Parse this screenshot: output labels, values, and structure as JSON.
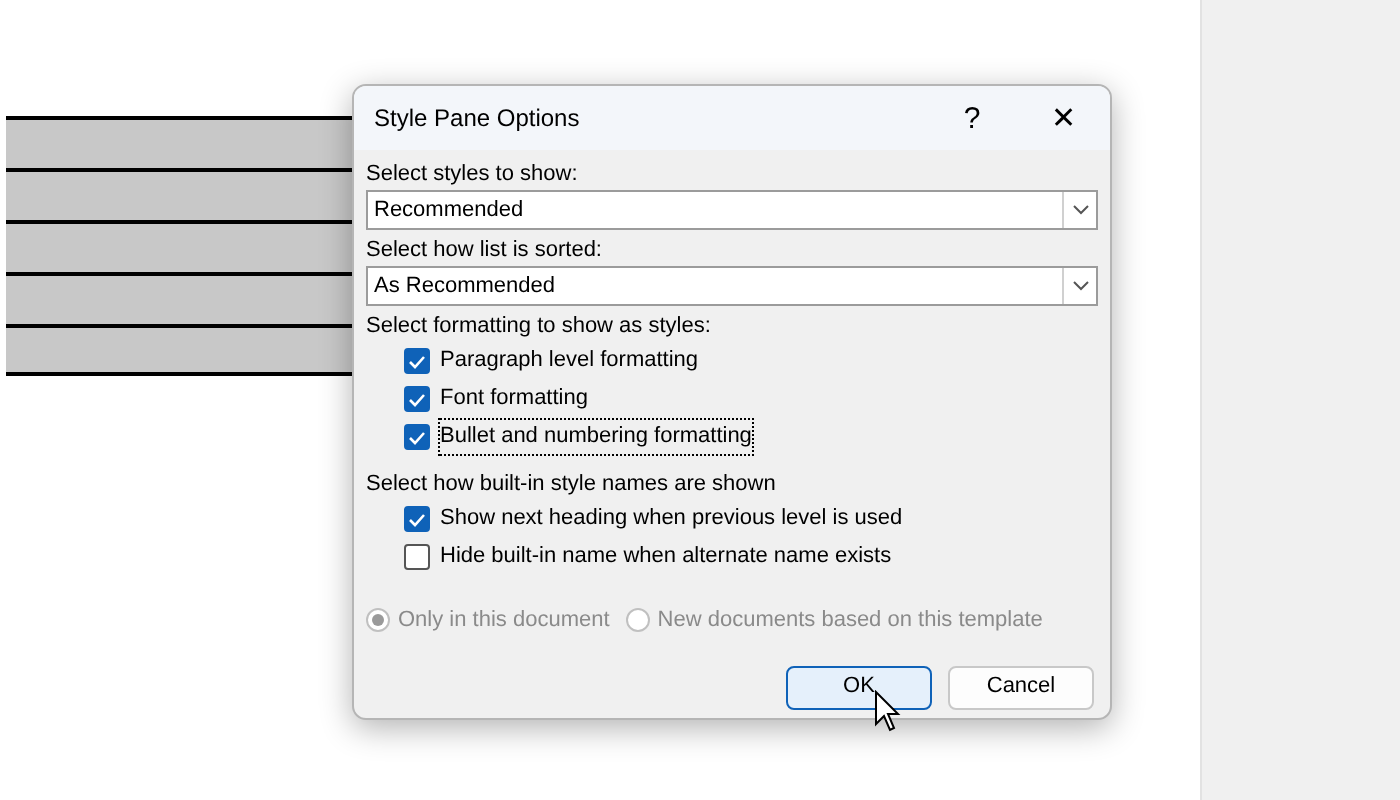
{
  "dialog": {
    "title": "Style Pane Options",
    "help": "?",
    "close": "✕",
    "styles_label": "Select styles to show:",
    "styles_select": {
      "value": "Recommended"
    },
    "sort_label": "Select how list is sorted:",
    "sort_select": {
      "value": "As Recommended"
    },
    "formatting_label": "Select formatting to show as styles:",
    "formatting_options": [
      {
        "label": "Paragraph level formatting",
        "checked": true,
        "focused": false
      },
      {
        "label": "Font formatting",
        "checked": true,
        "focused": false
      },
      {
        "label": "Bullet and numbering formatting",
        "checked": true,
        "focused": true
      }
    ],
    "names_label": "Select how built-in style names are shown",
    "names_options": [
      {
        "label": "Show next heading when previous level is used",
        "checked": true,
        "focused": false
      },
      {
        "label": "Hide built-in name when alternate name exists",
        "checked": false,
        "focused": false
      }
    ],
    "scope": [
      {
        "label": "Only in this document",
        "selected": true,
        "disabled": true
      },
      {
        "label": "New documents based on this template",
        "selected": false,
        "disabled": true
      }
    ],
    "buttons": [
      {
        "label": "OK",
        "default": true
      },
      {
        "label": "Cancel",
        "default": false
      }
    ]
  }
}
